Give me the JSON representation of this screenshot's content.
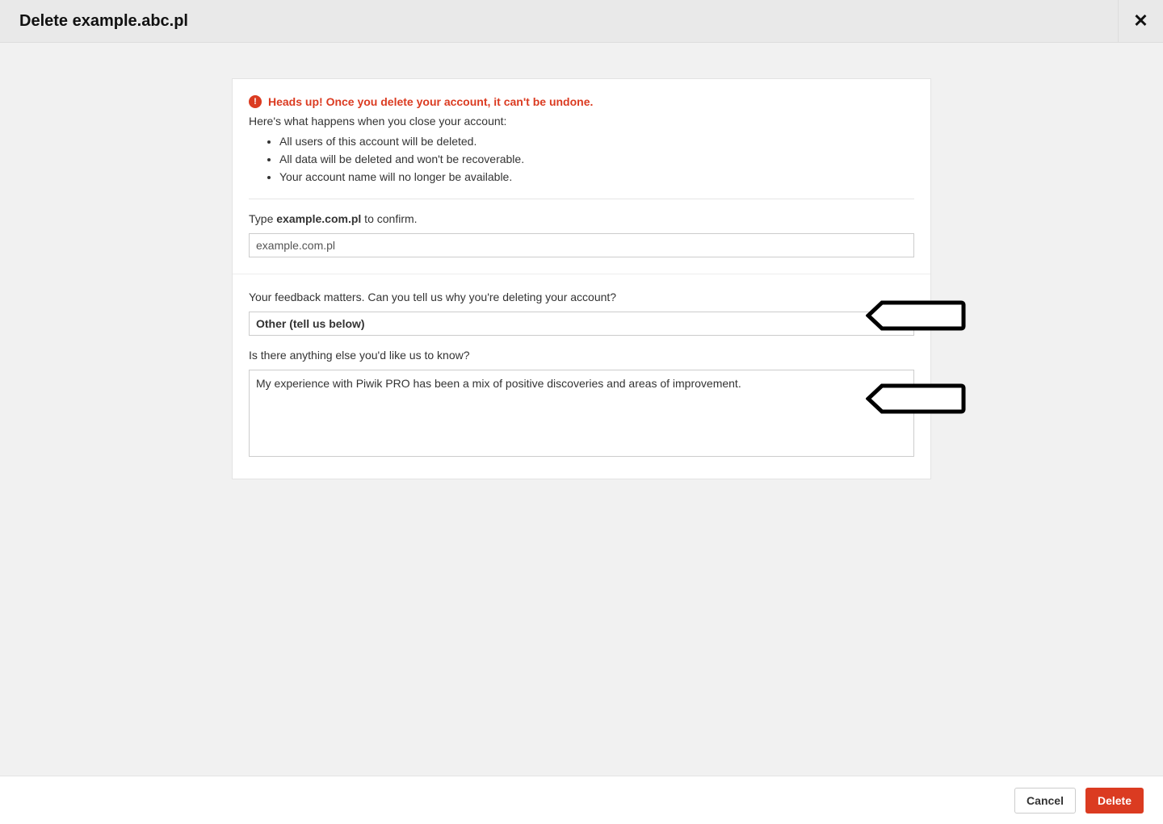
{
  "header": {
    "title": "Delete example.abc.pl"
  },
  "warning": {
    "text": "Heads up! Once you delete your account, it can't be undone."
  },
  "intro": "Here's what happens when you close your account:",
  "consequences": [
    "All users of this account will be deleted.",
    "All data will be deleted and won't be recoverable.",
    "Your account name will no longer be available."
  ],
  "confirm": {
    "prefix": "Type ",
    "name": "example.com.pl",
    "suffix": " to confirm.",
    "value": "example.com.pl"
  },
  "feedback": {
    "label": "Your feedback matters. Can you tell us why you're deleting your account?",
    "selected": "Other (tell us below)"
  },
  "extra": {
    "label": "Is there anything else you'd like us to know?",
    "value": "My experience with Piwik PRO has been a mix of positive discoveries and areas of improvement."
  },
  "footer": {
    "cancel": "Cancel",
    "delete": "Delete"
  }
}
